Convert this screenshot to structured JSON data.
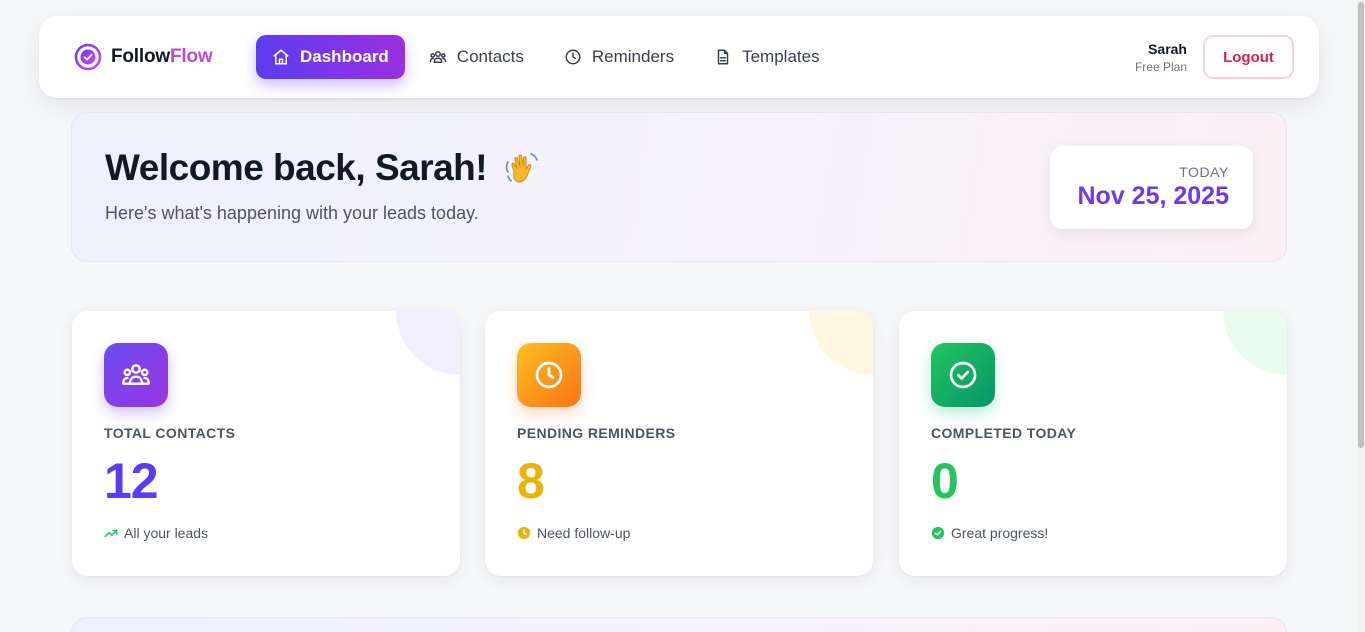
{
  "brand": {
    "part1": "Follow",
    "part2": "Flow",
    "accent_color": "#c04ad0"
  },
  "nav": {
    "items": [
      {
        "label": "Dashboard",
        "icon": "home-icon",
        "active": true
      },
      {
        "label": "Contacts",
        "icon": "users-icon",
        "active": false
      },
      {
        "label": "Reminders",
        "icon": "clock-icon",
        "active": false
      },
      {
        "label": "Templates",
        "icon": "document-icon",
        "active": false
      }
    ]
  },
  "user": {
    "name": "Sarah",
    "plan": "Free Plan",
    "logout_label": "Logout"
  },
  "welcome": {
    "title": "Welcome back, Sarah!",
    "subtitle": "Here's what's happening with your leads today.",
    "date_label": "TODAY",
    "date_value": "Nov 25, 2025"
  },
  "stats": [
    {
      "label": "TOTAL CONTACTS",
      "value": "12",
      "footer": "All your leads",
      "icon": "users-icon",
      "footer_icon": "trending-up-icon",
      "color": "#5b3cf0"
    },
    {
      "label": "PENDING REMINDERS",
      "value": "8",
      "footer": "Need follow-up",
      "icon": "clock-icon",
      "footer_icon": "clock-filled-icon",
      "color": "#eab308"
    },
    {
      "label": "COMPLETED TODAY",
      "value": "0",
      "footer": "Great progress!",
      "icon": "check-circle-icon",
      "footer_icon": "check-filled-icon",
      "color": "#22c55e"
    }
  ]
}
